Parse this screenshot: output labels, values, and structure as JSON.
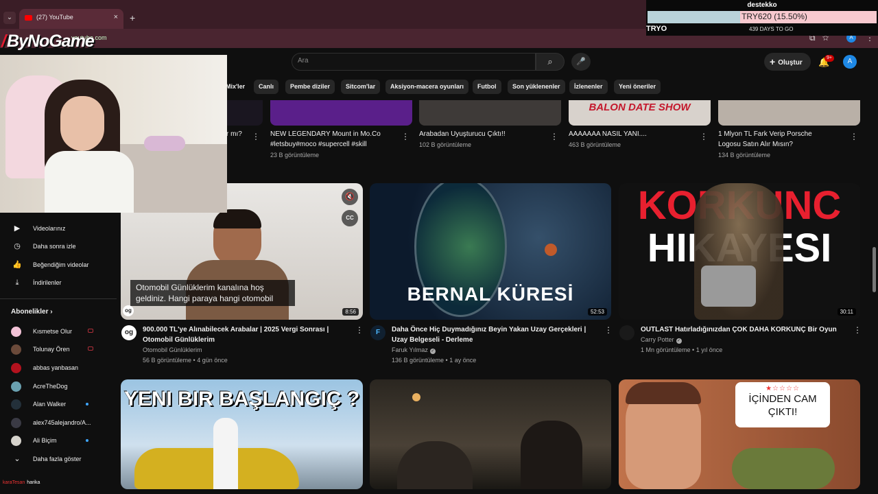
{
  "browser": {
    "tab_title": "(27) YouTube",
    "url": "youtube.com",
    "new_tab": "+",
    "close": "×"
  },
  "overlay": {
    "goal_title": "destekko",
    "goal_label": "TRY620 (15.50%)",
    "goal_progress": 0.155,
    "currency": "TRYO",
    "days_left": "439 DAYS TO GO",
    "logo": "ByNoGame"
  },
  "header": {
    "search_placeholder": "Ara",
    "create_label": "Oluştur",
    "notification_count": "9+",
    "avatar_letter": "A"
  },
  "chips": [
    "Mix'ler",
    "Canlı",
    "Pembe diziler",
    "Sitcom'lar",
    "Aksiyon-macera oyunları",
    "Futbol",
    "Son yüklenenler",
    "İzlenenler",
    "Yeni öneriler"
  ],
  "sidebar": {
    "items": [
      {
        "label": "Videolarınız",
        "icon": "▶"
      },
      {
        "label": "Daha sonra izle",
        "icon": "◷"
      },
      {
        "label": "Beğendiğim videolar",
        "icon": "👍"
      },
      {
        "label": "İndirilenler",
        "icon": "⤓"
      }
    ],
    "subs_heading": "Abonelikler",
    "subs_arrow": "›",
    "subscriptions": [
      "Kısmetse Olur",
      "Tolunay Ören",
      "abbas yanbasan",
      "AcreTheDog",
      "Alan Walker",
      "alex745alejandro/A...",
      "Ali Biçim"
    ],
    "show_more": "Daha fazla göster",
    "chat_user": "karaTesan",
    "chat_msg": "harika"
  },
  "top_row": [
    {
      "title": "r mı?",
      "meta": ""
    },
    {
      "title": "NEW LEGENDARY Mount in Mo.Co",
      "title2": "#letsbuy#moco #supercell #skill",
      "meta": "23 B görüntüleme"
    },
    {
      "title": "Arabadan Uyuşturucu Çıktı!!",
      "meta": "102 B görüntüleme"
    },
    {
      "title": "AAAAAAA NASIL YANI....",
      "meta": "463 B görüntüleme",
      "thumb_text": "BALON DATE SHOW"
    },
    {
      "title": "1 Mlyon TL Fark Verip Porsche",
      "title2": "Logosu Satın Alır Mısın?",
      "meta": "134 B görüntüleme"
    }
  ],
  "videos": [
    {
      "title1": "900.000 TL'ye Alınabilecek Arabalar | 2025 Vergi Sonrası |",
      "title2": "Otomobil Günlüklerim",
      "channel": "Otomobil Günlüklerim",
      "meta": "56 B görüntüleme • 4 gün önce",
      "duration": "8:56",
      "caption1": "Otomobil Günlüklerim kanalına hoş",
      "caption2": "geldiniz. Hangi paraya hangi otomobil",
      "avatar": "og"
    },
    {
      "title1": "Daha Önce Hiç Duymadığınız Beyin Yakan Uzay Gerçekleri |",
      "title2": "Uzay Belgeseli - Derleme",
      "channel": "Faruk Yılmaz",
      "meta": "136 B görüntüleme • 1 ay önce",
      "duration": "52:53",
      "thumb_text": "BERNAL KÜRESİ",
      "avatar": "F"
    },
    {
      "title1": "OUTLAST Hatırladığınızdan ÇOK DAHA KORKUNÇ Bir Oyun",
      "channel": "Carry Potter",
      "meta": "1 Mn görüntüleme • 1 yıl önce",
      "duration": "30:11",
      "thumb_text1": "KORKUNC",
      "thumb_text2": "HIKAYESI",
      "avatar": ""
    }
  ],
  "bottom_row": [
    {
      "thumb_text": "YENI BIR BAŞLANGIÇ ?"
    },
    {
      "thumb_text": ""
    },
    {
      "thumb_text1": "İÇİNDEN CAM",
      "thumb_text2": "ÇIKTI!"
    }
  ]
}
